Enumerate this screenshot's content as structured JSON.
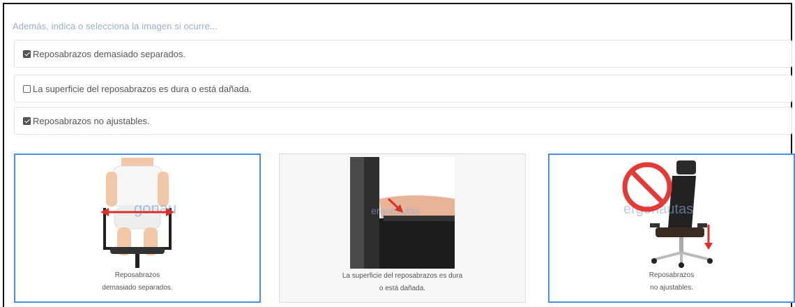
{
  "prompt": "Además, indica o selecciona la imagen si ocurre...",
  "options": [
    {
      "label": "Reposabrazos demasiado separados.",
      "checked": true
    },
    {
      "label": "La superficie del reposabrazos es dura o está dañada.",
      "checked": false
    },
    {
      "label": "Reposabrazos no ajustables.",
      "checked": true
    }
  ],
  "cards": [
    {
      "line1": "Reposabrazos",
      "line2": "demasiado separados.",
      "selected": true,
      "watermark": "ergonautas",
      "icon": "chair-wide-armrests-image"
    },
    {
      "line1": "La superficie del reposabrazos es dura",
      "line2": "o está dañada.",
      "selected": false,
      "watermark": "ergonautas",
      "icon": "hard-armrest-image"
    },
    {
      "line1": "Reposabrazos",
      "line2": "no ajustables.",
      "selected": true,
      "watermark": "ergonautas",
      "icon": "non-adjustable-armrest-image"
    }
  ],
  "colors": {
    "accent": "#4a90e2",
    "prohibit": "#e53935",
    "arrow": "#d9302b"
  }
}
